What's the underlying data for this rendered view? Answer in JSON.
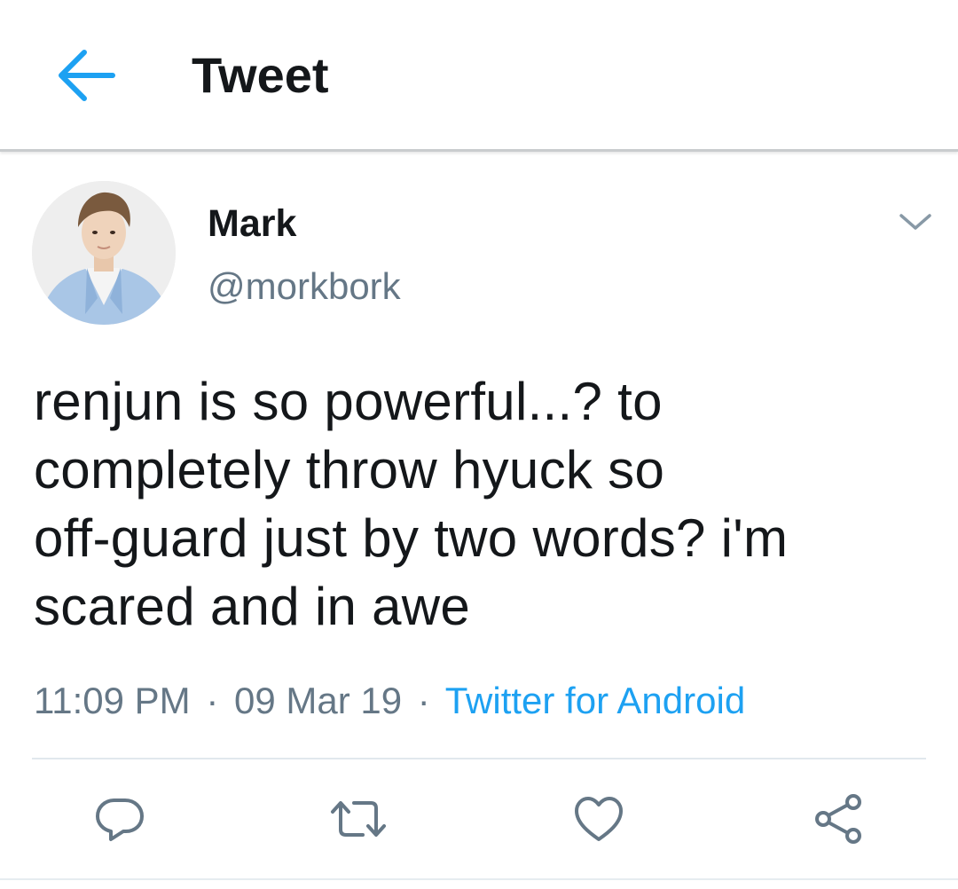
{
  "header": {
    "title": "Tweet",
    "back_icon": "arrow-left-icon",
    "accent_color": "#1da1f2"
  },
  "author": {
    "display_name": "Mark",
    "handle": "@morkbork",
    "menu_icon": "chevron-down-icon"
  },
  "tweet": {
    "text_lines": [
      "renjun is so powerful...? to",
      "completely throw hyuck so",
      "off-guard just by two words? i'm",
      "scared and in awe"
    ],
    "time": "11:09 PM",
    "date": "09 Mar 19",
    "separator": "·",
    "source": "Twitter for Android"
  },
  "actions": [
    {
      "name": "reply",
      "icon": "reply-bubble-icon"
    },
    {
      "name": "retweet",
      "icon": "retweet-icon"
    },
    {
      "name": "like",
      "icon": "heart-icon"
    },
    {
      "name": "share",
      "icon": "share-icon"
    }
  ],
  "colors": {
    "text_primary": "#14171a",
    "text_secondary": "#657786",
    "link": "#1da1f2",
    "icon_gray": "#657786"
  }
}
